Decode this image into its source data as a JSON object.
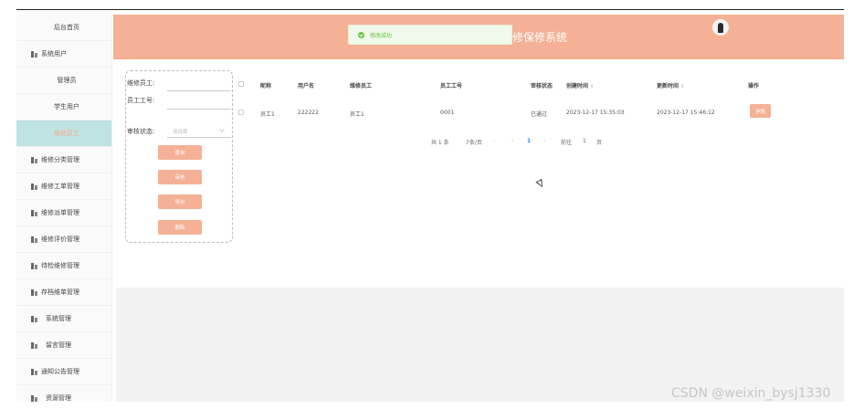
{
  "sidebar": {
    "items": [
      {
        "label": "后台首页"
      },
      {
        "label": "系统用户"
      },
      {
        "label": "管理员"
      },
      {
        "label": "学生用户"
      },
      {
        "label": "维修员工"
      },
      {
        "label": "维修分类管理"
      },
      {
        "label": "维修工单管理"
      },
      {
        "label": "维修派单管理"
      },
      {
        "label": "维修评价管理"
      },
      {
        "label": "待检维修管理"
      },
      {
        "label": "存档维单管理"
      },
      {
        "label": "系统管理"
      },
      {
        "label": "留言管理"
      },
      {
        "label": "通知公告管理"
      },
      {
        "label": "资源管理"
      }
    ]
  },
  "header": {
    "title": "修保修系统"
  },
  "toast": {
    "message": "修改成功"
  },
  "search": {
    "staff_label": "维修员工:",
    "staff_no_label": "员工工号:",
    "status_label": "审核状态:",
    "status_placeholder": "请选择",
    "buttons": {
      "query": "查询",
      "add": "审核",
      "export": "导出",
      "delete": "删除"
    }
  },
  "table": {
    "headers": {
      "nickname": "昵称",
      "username": "用户名",
      "staff": "维修员工",
      "staff_no": "员工工号",
      "status": "审核状态",
      "created": "创建时间",
      "updated": "更新时间",
      "action": "操作"
    },
    "sort_glyph": "⇕",
    "rows": [
      {
        "nickname": "员工1",
        "username": "222222",
        "staff": "员工1",
        "staff_no": "0001",
        "status": "已通过",
        "created": "2023-12-17 15:35:03",
        "updated": "2023-12-17 15:46:12",
        "action": "详情"
      }
    ]
  },
  "pagination": {
    "total": "共 1 条",
    "page_size": "7条/页",
    "prev_jump": "‹",
    "prev": "‹",
    "current": "1",
    "next": "›",
    "goto_label": "前往",
    "goto_value": "1",
    "page_suffix": "页"
  },
  "watermark": "CSDN @weixin_bysj1330"
}
